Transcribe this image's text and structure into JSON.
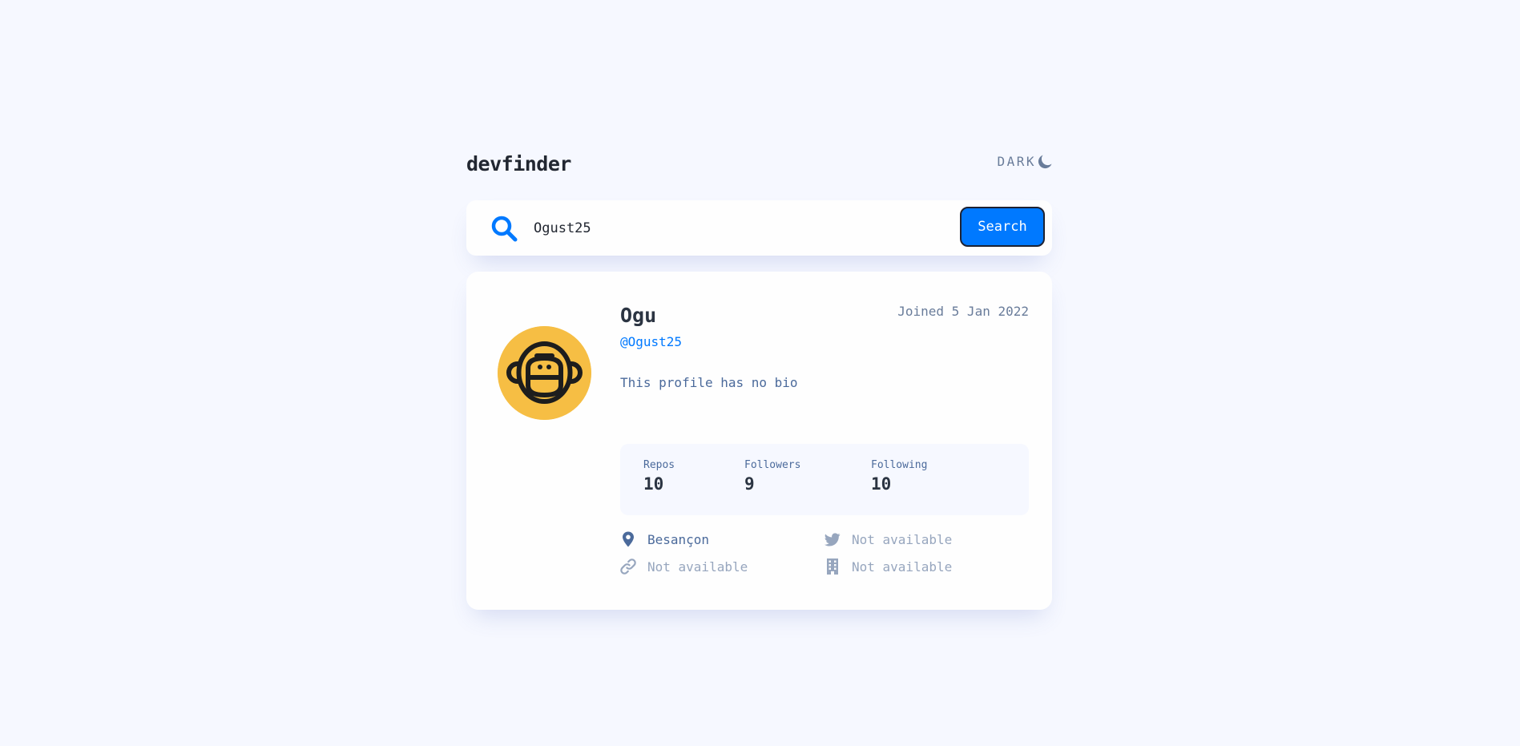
{
  "header": {
    "brand": "devfinder",
    "theme_label": "DARK",
    "theme_icon": "moon-icon"
  },
  "search": {
    "value": "Ogust25",
    "placeholder": "Search GitHub username…",
    "button_label": "Search",
    "icon": "search-icon"
  },
  "profile": {
    "name": "Ogu",
    "login": "@Ogust25",
    "joined": "Joined 5 Jan 2022",
    "bio": "This profile has no bio",
    "avatar_icon": "monkey-avatar"
  },
  "stats": [
    {
      "label": "Repos",
      "value": "10"
    },
    {
      "label": "Followers",
      "value": "9"
    },
    {
      "label": "Following",
      "value": "10"
    }
  ],
  "links": {
    "location": {
      "text": "Besançon",
      "icon": "location-pin-icon"
    },
    "twitter": {
      "text": "Not available",
      "icon": "twitter-icon"
    },
    "website": {
      "text": "Not available",
      "icon": "link-icon"
    },
    "company": {
      "text": "Not available",
      "icon": "building-icon"
    }
  },
  "colors": {
    "background": "#f6f8ff",
    "card": "#fefefe",
    "accent": "#0079ff",
    "text_dark": "#2b3442",
    "text_muted": "#4b6a9b",
    "text_unavailable": "#97a6be",
    "avatar_bg": "#f6be44"
  }
}
